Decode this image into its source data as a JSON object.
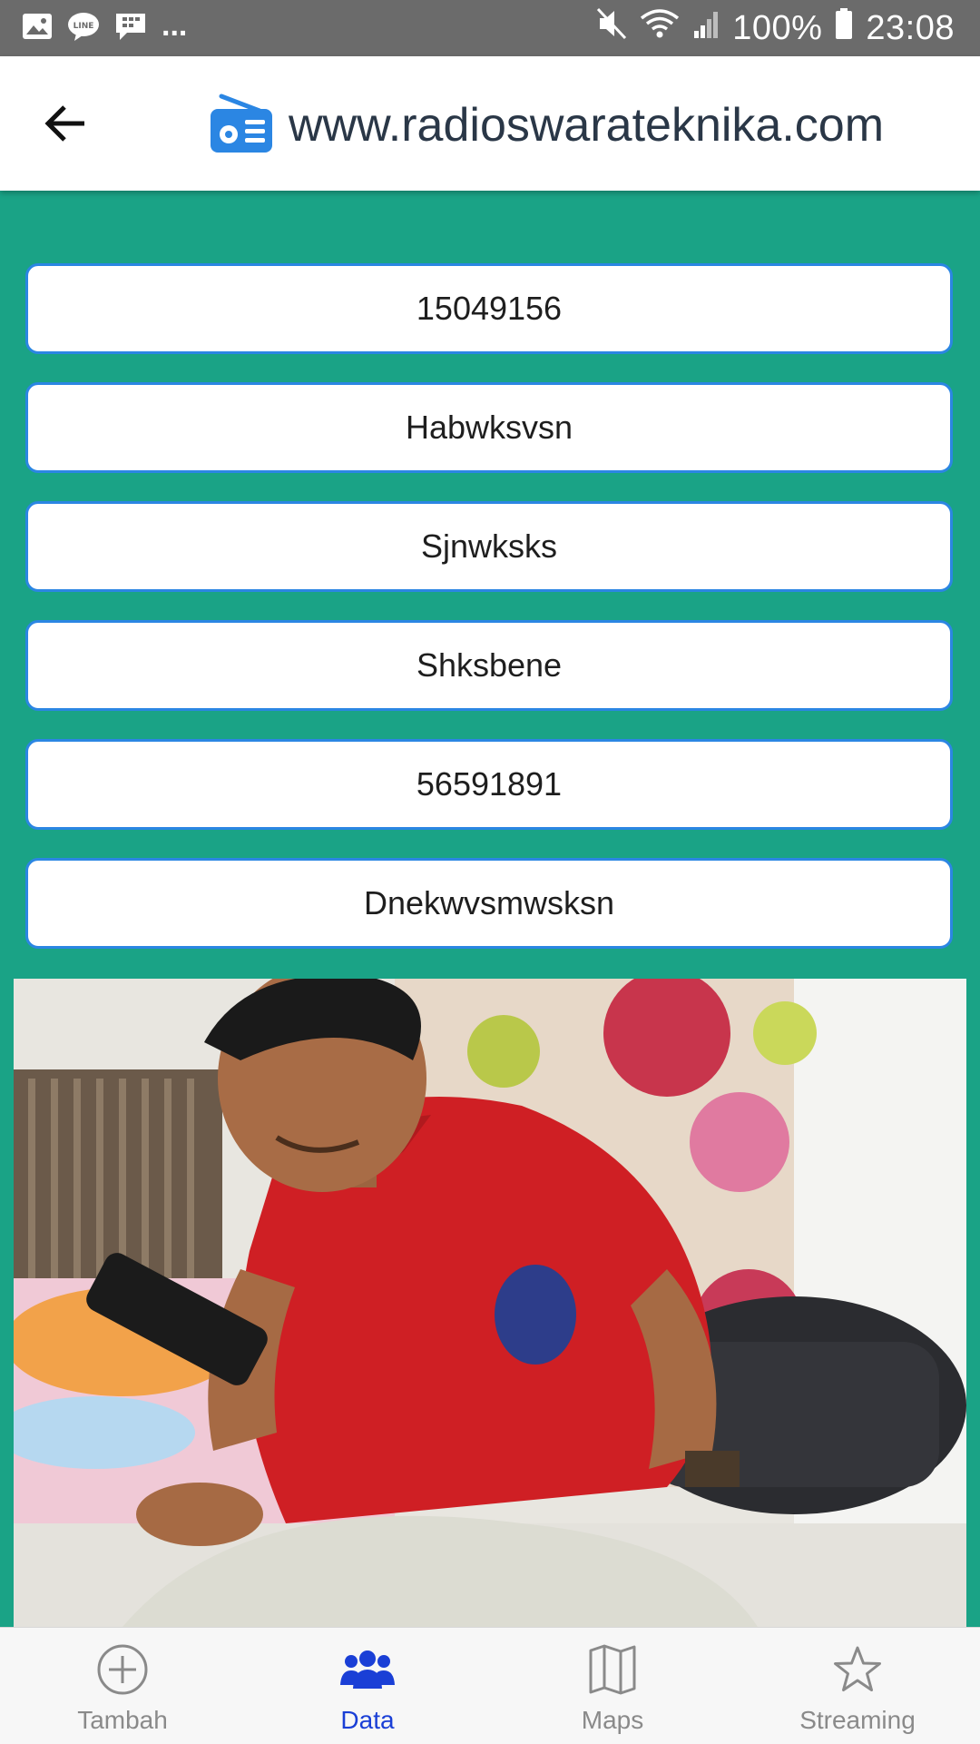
{
  "status_bar": {
    "left_icons": [
      "gallery-icon",
      "line-icon",
      "bbm-icon"
    ],
    "overflow": "...",
    "right_icons": [
      "mute-icon",
      "wifi-icon",
      "signal-icon",
      "battery-icon"
    ],
    "battery": "100%",
    "time": "23:08"
  },
  "app_bar": {
    "back_icon": "arrow-left-icon",
    "logo_icon": "radio-icon",
    "title": "www.radioswarateknika.com",
    "accent": "#2b86e3"
  },
  "fields": [
    {
      "value": "15049156"
    },
    {
      "value": "Habwksvsn"
    },
    {
      "value": "Sjnwksks"
    },
    {
      "value": "Shksbene"
    },
    {
      "value": "56591891"
    },
    {
      "value": "Dnekwvsmwsksn"
    }
  ],
  "photo": {
    "description_icon": "profile-photo"
  },
  "bottom_nav": {
    "items": [
      {
        "label": "Tambah",
        "icon": "plus-circle-icon",
        "active": false
      },
      {
        "label": "Data",
        "icon": "people-icon",
        "active": true
      },
      {
        "label": "Maps",
        "icon": "map-icon",
        "active": false
      },
      {
        "label": "Streaming",
        "icon": "star-icon",
        "active": false
      }
    ]
  },
  "colors": {
    "background": "#1aa386",
    "field_border": "#2b86e3",
    "nav_active": "#1a3fd6",
    "nav_inactive": "#8a8a8a"
  }
}
